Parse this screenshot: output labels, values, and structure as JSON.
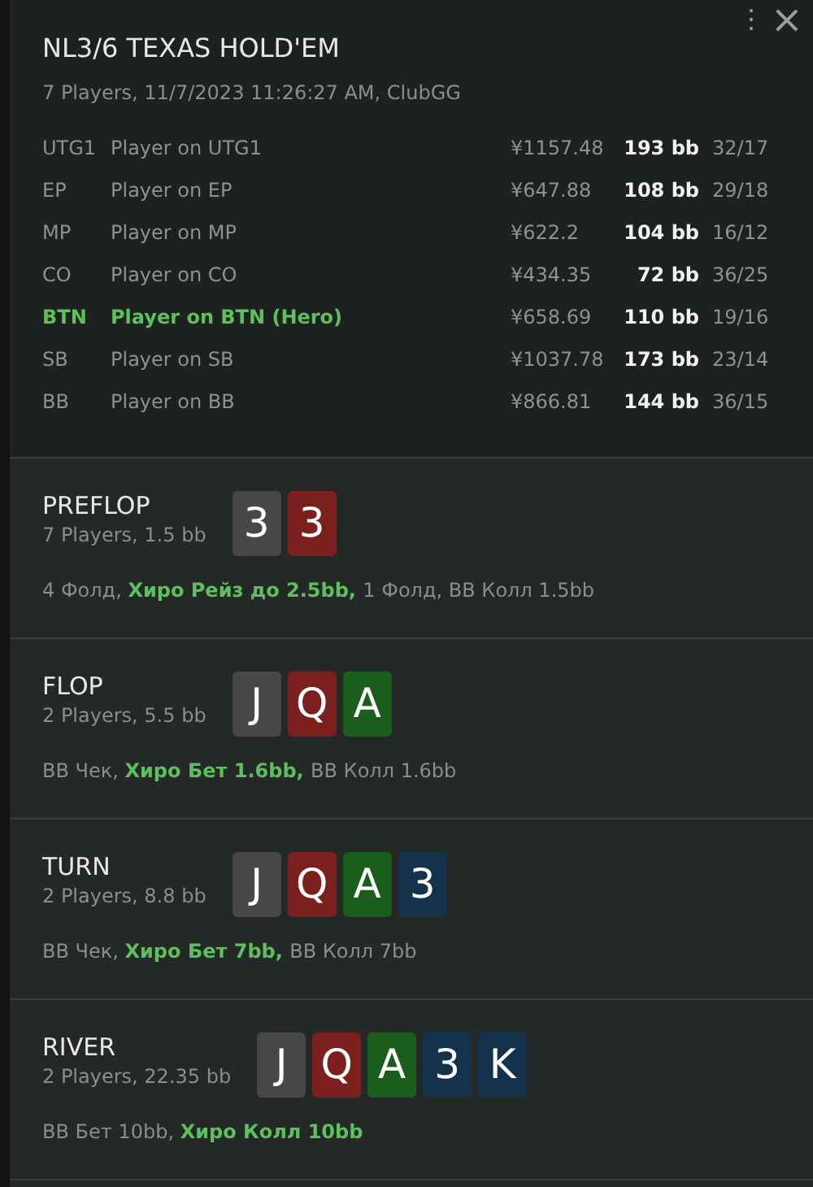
{
  "header": {
    "title": "NL3/6 TEXAS HOLD'EM",
    "subtitle": "7 Players, 11/7/2023 11:26:27 AM, ClubGG",
    "menu_icon": "⋮",
    "close_icon": "×"
  },
  "players": [
    {
      "position": "UTG1",
      "name": "Player on UTG1",
      "stack": "¥1157.48",
      "bb": "193 bb",
      "stats": "32/17",
      "hero": false
    },
    {
      "position": "EP",
      "name": "Player on EP",
      "stack": "¥647.88",
      "bb": "108 bb",
      "stats": "29/18",
      "hero": false
    },
    {
      "position": "MP",
      "name": "Player on MP",
      "stack": "¥622.2",
      "bb": "104 bb",
      "stats": "16/12",
      "hero": false
    },
    {
      "position": "CO",
      "name": "Player on CO",
      "stack": "¥434.35",
      "bb": "72 bb",
      "stats": "36/25",
      "hero": false
    },
    {
      "position": "BTN",
      "name": "Player on BTN (Hero)",
      "stack": "¥658.69",
      "bb": "110 bb",
      "stats": "19/16",
      "hero": true
    },
    {
      "position": "SB",
      "name": "Player on SB",
      "stack": "¥1037.78",
      "bb": "173 bb",
      "stats": "23/14",
      "hero": false
    },
    {
      "position": "BB",
      "name": "Player on BB",
      "stack": "¥866.81",
      "bb": "144 bb",
      "stats": "36/15",
      "hero": false
    }
  ],
  "streets": [
    {
      "name": "PREFLOP",
      "info": "7 Players, 1.5 bb",
      "cards": [
        {
          "rank": "3",
          "color": "#474747"
        },
        {
          "rank": "3",
          "color": "#7b1f1f"
        }
      ],
      "actions": [
        {
          "text": "4 Фолд, ",
          "hero": false
        },
        {
          "text": "Хиро Рейз до 2.5bb, ",
          "hero": true
        },
        {
          "text": "1 Фолд, ВВ Колл 1.5bb",
          "hero": false
        }
      ]
    },
    {
      "name": "FLOP",
      "info": "2 Players, 5.5 bb",
      "cards": [
        {
          "rank": "J",
          "color": "#474747"
        },
        {
          "rank": "Q",
          "color": "#7b1f1f"
        },
        {
          "rank": "A",
          "color": "#1b5e1b"
        }
      ],
      "actions": [
        {
          "text": "BB Чек, ",
          "hero": false
        },
        {
          "text": "Хиро Бет 1.6bb, ",
          "hero": true
        },
        {
          "text": "BB Колл 1.6bb",
          "hero": false
        }
      ]
    },
    {
      "name": "TURN",
      "info": "2 Players, 8.8 bb",
      "cards": [
        {
          "rank": "J",
          "color": "#474747"
        },
        {
          "rank": "Q",
          "color": "#7b1f1f"
        },
        {
          "rank": "A",
          "color": "#1b5e1b"
        },
        {
          "rank": "3",
          "color": "#15324d"
        }
      ],
      "actions": [
        {
          "text": "BB Чек, ",
          "hero": false
        },
        {
          "text": "Хиро Бет 7bb, ",
          "hero": true
        },
        {
          "text": "BB Колл 7bb",
          "hero": false
        }
      ]
    },
    {
      "name": "RIVER",
      "info": "2 Players, 22.35 bb",
      "cards": [
        {
          "rank": "J",
          "color": "#474747"
        },
        {
          "rank": "Q",
          "color": "#7b1f1f"
        },
        {
          "rank": "A",
          "color": "#1b5e1b"
        },
        {
          "rank": "3",
          "color": "#15324d"
        },
        {
          "rank": "K",
          "color": "#15324d"
        }
      ],
      "actions": [
        {
          "text": "BB Бет 10bb, ",
          "hero": false
        },
        {
          "text": "Хиро Колл 10bb",
          "hero": true
        }
      ]
    }
  ]
}
